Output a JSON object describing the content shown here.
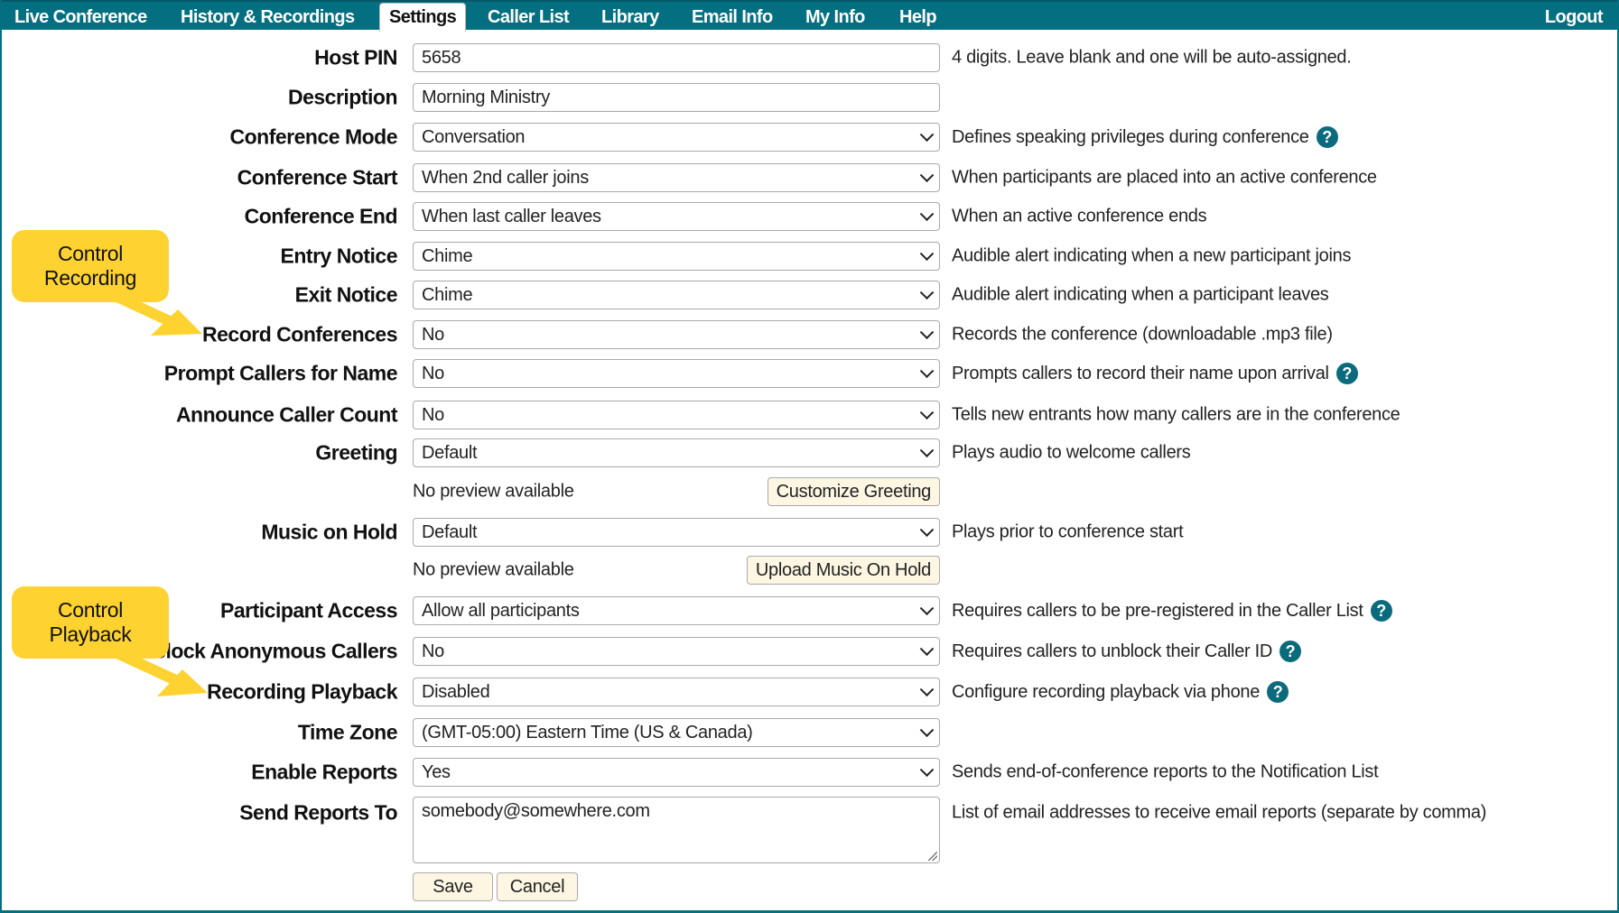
{
  "nav": {
    "tabs": [
      {
        "label": "Live Conference"
      },
      {
        "label": "History & Recordings"
      },
      {
        "label": "Settings",
        "active": true
      },
      {
        "label": "Caller List"
      },
      {
        "label": "Library"
      },
      {
        "label": "Email Info"
      },
      {
        "label": "My Info"
      },
      {
        "label": "Help"
      }
    ],
    "logout": "Logout"
  },
  "settings": [
    {
      "label": "Host PIN",
      "type": "text",
      "value": "5658",
      "help": "4 digits. Leave blank and one will be auto-assigned.",
      "help_icon": false
    },
    {
      "label": "Description",
      "type": "text",
      "value": "Morning Ministry",
      "help": "",
      "help_icon": false
    },
    {
      "label": "Conference Mode",
      "type": "select",
      "value": "Conversation",
      "help": "Defines speaking privileges during conference",
      "help_icon": true
    },
    {
      "label": "Conference Start",
      "type": "select",
      "value": "When 2nd caller joins",
      "help": "When participants are placed into an active conference",
      "help_icon": false
    },
    {
      "label": "Conference End",
      "type": "select",
      "value": "When last caller leaves",
      "help": "When an active conference ends",
      "help_icon": false
    },
    {
      "label": "Entry Notice",
      "type": "select",
      "value": "Chime",
      "help": "Audible alert indicating when a new participant joins",
      "help_icon": false
    },
    {
      "label": "Exit Notice",
      "type": "select",
      "value": "Chime",
      "help": "Audible alert indicating when a participant leaves",
      "help_icon": false
    },
    {
      "label": "Record Conferences",
      "type": "select",
      "value": "No",
      "help": "Records the conference (downloadable .mp3 file)",
      "help_icon": false
    },
    {
      "label": "Prompt Callers for Name",
      "type": "select",
      "value": "No",
      "help": "Prompts callers to record their name upon arrival",
      "help_icon": true
    },
    {
      "label": "Announce Caller Count",
      "type": "select",
      "value": "No",
      "help": "Tells new entrants how many callers are in the conference",
      "help_icon": false
    },
    {
      "label": "Greeting",
      "type": "select",
      "value": "Default",
      "help": "Plays audio to welcome callers",
      "help_icon": false
    },
    {
      "label": "Music on Hold",
      "type": "select",
      "value": "Default",
      "help": "Plays prior to conference start",
      "help_icon": false
    },
    {
      "label": "Participant Access",
      "type": "select",
      "value": "Allow all participants",
      "help": "Requires callers to be pre-registered in the Caller List",
      "help_icon": true
    },
    {
      "label": "Block Anonymous Callers",
      "type": "select",
      "value": "No",
      "help": "Requires callers to unblock their Caller ID",
      "help_icon": true
    },
    {
      "label": "Recording Playback",
      "type": "select",
      "value": "Disabled",
      "help": "Configure recording playback via phone",
      "help_icon": true
    },
    {
      "label": "Time Zone",
      "type": "select",
      "value": "(GMT-05:00) Eastern Time (US & Canada)",
      "help": "",
      "help_icon": false
    },
    {
      "label": "Enable Reports",
      "type": "select",
      "value": "Yes",
      "help": "Sends end-of-conference reports to the Notification List",
      "help_icon": false
    },
    {
      "label": "Send Reports To",
      "type": "textarea",
      "value": "somebody@somewhere.com",
      "help": "List of email addresses to receive email reports (separate by comma)",
      "help_icon": false
    }
  ],
  "greeting_extra": {
    "preview": "No preview available",
    "button": "Customize Greeting"
  },
  "moh_extra": {
    "preview": "No preview available",
    "button": "Upload Music On Hold"
  },
  "actions": {
    "save": "Save",
    "cancel": "Cancel"
  },
  "help_icon_glyph": "?",
  "callouts": [
    {
      "text_line1": "Control",
      "text_line2": "Recording"
    },
    {
      "text_line1": "Control",
      "text_line2": "Playback"
    }
  ],
  "colors": {
    "brand": "#046f80",
    "callout": "#fed230",
    "button_bg": "#fdf6e3"
  }
}
